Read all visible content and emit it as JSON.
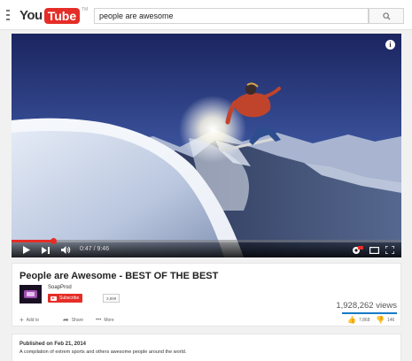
{
  "brand": {
    "you": "You",
    "tube": "Tube",
    "tm": "TM"
  },
  "search": {
    "query": "people are awesome",
    "button_icon": "search-icon"
  },
  "player": {
    "time": "0:47 / 9:46",
    "progress_fraction": 0.107,
    "info_label": "i",
    "icons": [
      "play-icon",
      "next-icon",
      "volume-icon",
      "hd-settings-icon",
      "theater-mode-icon",
      "fullscreen-icon",
      "info-icon"
    ]
  },
  "video": {
    "title": "People are Awesome - BEST OF THE BEST",
    "channel": "SoapProd",
    "subscribe_label": "Subscribe",
    "subscriber_count": "3,899",
    "views": "1,928,262 views",
    "actions": {
      "add_to": "Add to",
      "share": "Share",
      "more": "More"
    },
    "likes": "7,868",
    "dislikes": "146"
  },
  "description": {
    "published": "Published on Feb 21, 2014",
    "text": "A compilation of extrem sports and others awesome people around the world."
  },
  "colors": {
    "brand_red": "#e52d27",
    "sentiment_blue": "#167ac6"
  }
}
